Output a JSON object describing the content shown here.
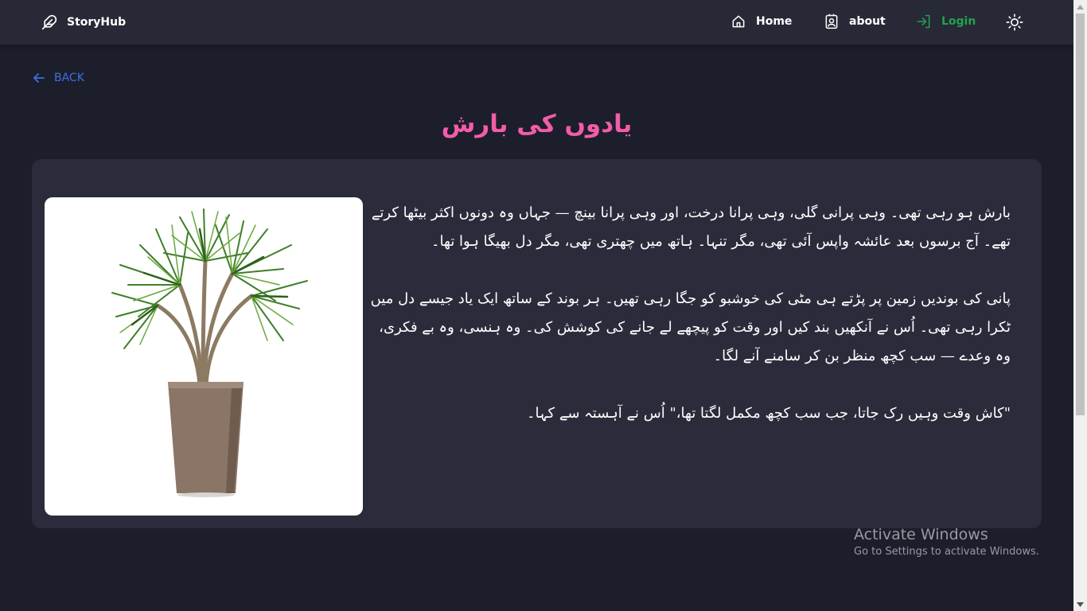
{
  "navbar": {
    "brand_name": "StoryHub",
    "brand_icon": "feather-icon",
    "items": [
      {
        "label": "Home",
        "icon": "home-icon"
      },
      {
        "label": "about",
        "icon": "contact-card-icon"
      },
      {
        "label": "Login",
        "icon": "login-icon",
        "color": "#22a24a"
      }
    ],
    "theme_icon": "sun-icon"
  },
  "back": {
    "label": "BACK",
    "icon": "arrow-left-icon",
    "color": "#3b6fe6"
  },
  "story": {
    "title": "یادوں کی بارش",
    "title_color": "#f25ca8",
    "image_subject": "potted-dracaena-plant",
    "paragraphs": [
      "بارش ہو رہی تھی۔ وہی پرانی گلی، وہی پرانا درخت، اور وہی پرانا بینچ — جہاں وہ دونوں اکثر بیٹھا کرتے تھے۔ آج برسوں بعد عائشہ واپس آئی تھی، مگر تنہا۔ ہاتھ میں چھتری تھی، مگر دل بھیگا ہوا تھا۔",
      "پانی کی بوندیں زمین پر پڑتے ہی مٹی کی خوشبو کو جگا رہی تھیں۔ ہر بوند کے ساتھ ایک یاد جیسے دل میں ٹکرا رہی تھی۔ اُس نے آنکھیں بند کیں اور وقت کو پیچھے لے جانے کی کوشش کی۔ وہ ہنسی، وہ بے فکری، وہ وعدے — سب کچھ منظر بن کر سامنے آنے لگا۔",
      "\"کاش وقت وہیں رک جاتا، جب سب کچھ مکمل لگتا تھا،\" اُس نے آہستہ سے کہا۔"
    ]
  },
  "watermark": {
    "title": "Activate Windows",
    "subtitle": "Go to Settings to activate Windows."
  },
  "colors": {
    "background": "#1d1e2b",
    "navbar": "#272937",
    "card": "#2a2c3b"
  }
}
